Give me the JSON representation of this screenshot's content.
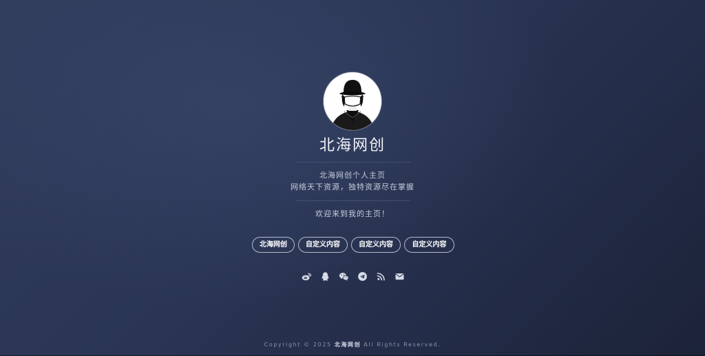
{
  "profile": {
    "name": "北海网创",
    "description_line1": "北海网创个人主页",
    "description_line2": "网络天下资源，独特资源尽在掌握",
    "welcome": "欢迎来到我的主页！"
  },
  "links": [
    {
      "label": "北海网创"
    },
    {
      "label": "自定义内容"
    },
    {
      "label": "自定义内容"
    },
    {
      "label": "自定义内容"
    }
  ],
  "social_icons": [
    "weibo-icon",
    "qq-icon",
    "wechat-icon",
    "telegram-icon",
    "rss-icon",
    "email-icon"
  ],
  "footer": {
    "prefix": "Copyright © 2025",
    "brand": "北海网创",
    "suffix": "All Rights Reserved."
  },
  "colors": {
    "background_start": "#313c5c",
    "background_end": "#1c2338",
    "text": "#d9deea",
    "button_border": "#e6ebf5"
  }
}
